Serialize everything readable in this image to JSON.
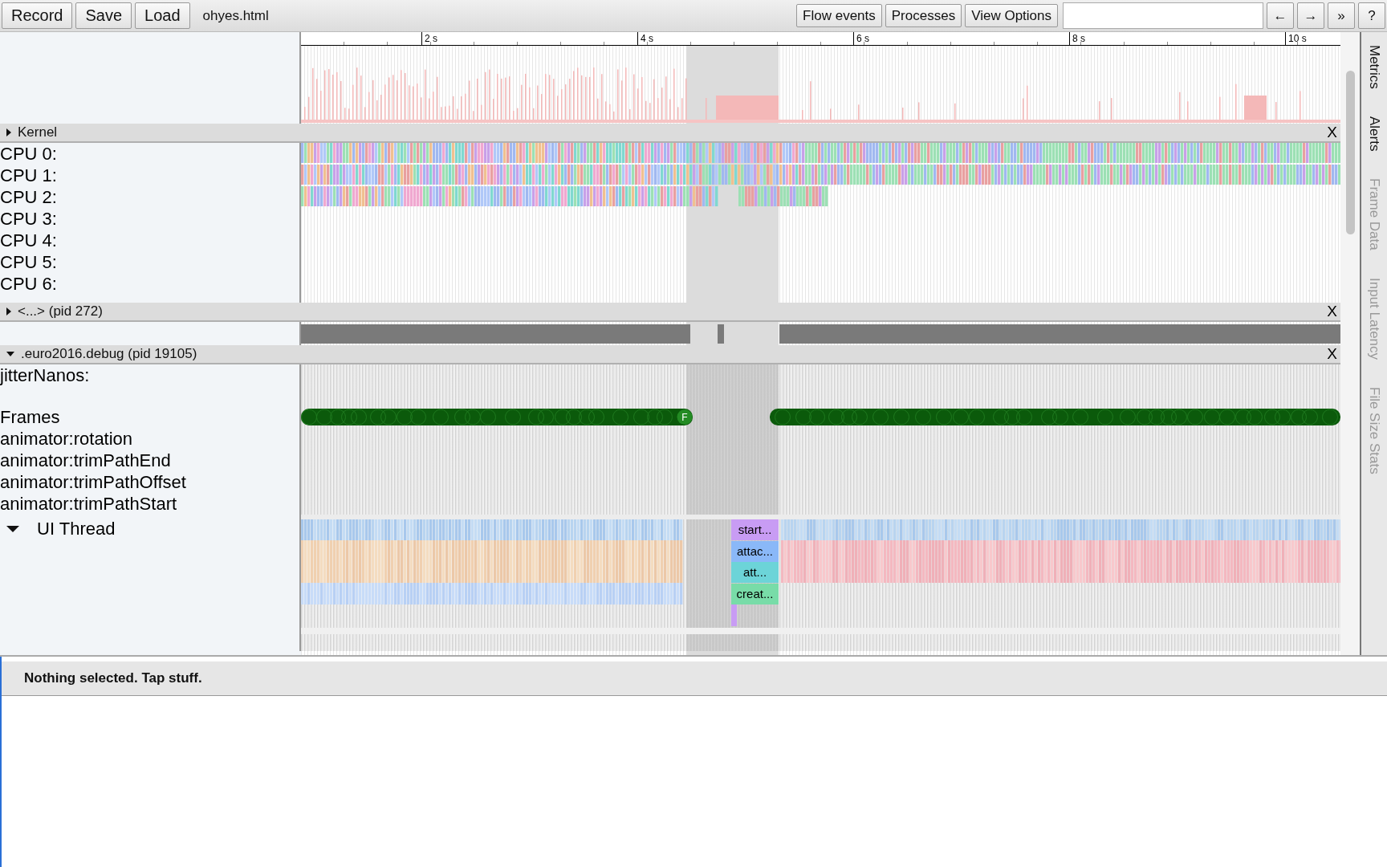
{
  "toolbar": {
    "buttons": [
      "Record",
      "Save",
      "Load"
    ],
    "filename": "ohyes.html",
    "view_buttons": [
      "Flow events",
      "Processes",
      "View Options"
    ],
    "nav_buttons": [
      "←",
      "→",
      "»",
      "?"
    ]
  },
  "ruler": {
    "ticks": [
      "2 s",
      "4 s",
      "6 s",
      "8 s",
      "10 s"
    ]
  },
  "groups": [
    {
      "kind": "kernel",
      "label": "Kernel",
      "expanded": false,
      "close": "X",
      "rows": [
        {
          "label": "CPU 0:"
        },
        {
          "label": "CPU 1:"
        },
        {
          "label": "CPU 2:"
        },
        {
          "label": "CPU 3:"
        },
        {
          "label": "CPU 4:"
        },
        {
          "label": "CPU 5:"
        },
        {
          "label": "CPU 6:"
        }
      ]
    },
    {
      "kind": "process",
      "label": "<...> (pid 272)",
      "expanded": false,
      "close": "X"
    },
    {
      "kind": "app",
      "label": ".euro2016.debug (pid 19105)",
      "expanded": true,
      "close": "X",
      "rows": [
        {
          "kind": "counter",
          "label": "jitterNanos:"
        },
        {
          "kind": "frames",
          "label": "Frames",
          "marker": "F"
        },
        {
          "kind": "async",
          "label": "animator:rotation"
        },
        {
          "kind": "async",
          "label": "animator:trimPathEnd"
        },
        {
          "kind": "async",
          "label": "animator:trimPathOffset"
        },
        {
          "kind": "async",
          "label": "animator:trimPathStart"
        },
        {
          "kind": "thread",
          "label": "UI Thread",
          "expanded": true,
          "slices": [
            {
              "label": "start...",
              "color": "#c89cf4"
            },
            {
              "label": "attac...",
              "color": "#8ab8f8"
            },
            {
              "label": "att...",
              "color": "#6cd4d8"
            },
            {
              "label": "creat...",
              "color": "#78dca8"
            }
          ]
        }
      ]
    }
  ],
  "side_tabs": [
    {
      "label": "Metrics",
      "disabled": false
    },
    {
      "label": "Alerts",
      "disabled": false
    },
    {
      "label": "Frame Data",
      "disabled": true
    },
    {
      "label": "Input Latency",
      "disabled": true
    },
    {
      "label": "File Size Stats",
      "disabled": true
    }
  ],
  "analysis": {
    "message": "Nothing selected. Tap stuff."
  }
}
